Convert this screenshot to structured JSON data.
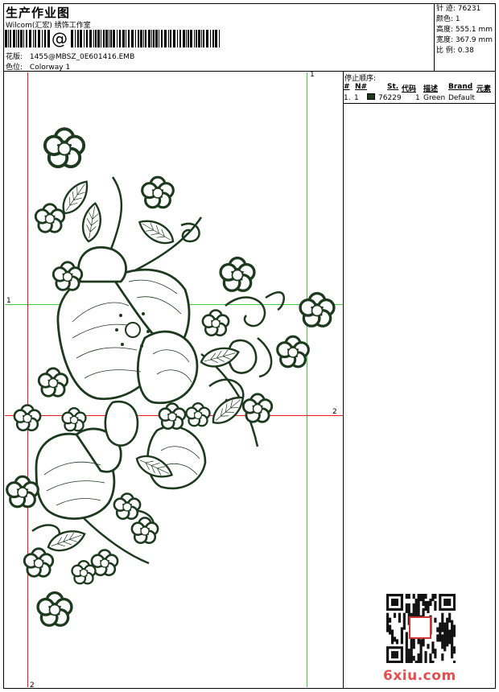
{
  "header": {
    "title": "生产作业图",
    "subtitle": "Wilcom(汇宏) 绣饰工作室",
    "barcode_symbol": "@",
    "design_label": "花版:",
    "design_value": "1455@MBSZ_0E601416.EMB",
    "colorway_label": "色位:",
    "colorway_value": "Colorway 1"
  },
  "stats": {
    "stitches": "针 迹: 76231",
    "colors": "颜色: 1",
    "height": "高度: 555.1 mm",
    "width": "宽度: 367.9 mm",
    "scale": "比 例: 0.38"
  },
  "stop_sequence": {
    "title": "停止顺序:",
    "headers": [
      "#",
      "N#",
      "St.",
      "代码",
      "描述",
      "Brand",
      "元素"
    ],
    "rows": [
      {
        "num": "1.",
        "needle": "1",
        "stitches": "76229",
        "code": "1",
        "desc": "Green",
        "brand": "Default",
        "swatch": "#1e3a1e"
      }
    ]
  },
  "guides": {
    "green_top": "1",
    "green_left": "1",
    "red_right": "2",
    "red_bottom": "2"
  },
  "colors": {
    "thread": "#1e3a1e",
    "guide_green": "#3cd23c",
    "guide_red": "#e81c1c",
    "watermark": "#e05050"
  },
  "watermark": {
    "text": "6xiu.com"
  }
}
